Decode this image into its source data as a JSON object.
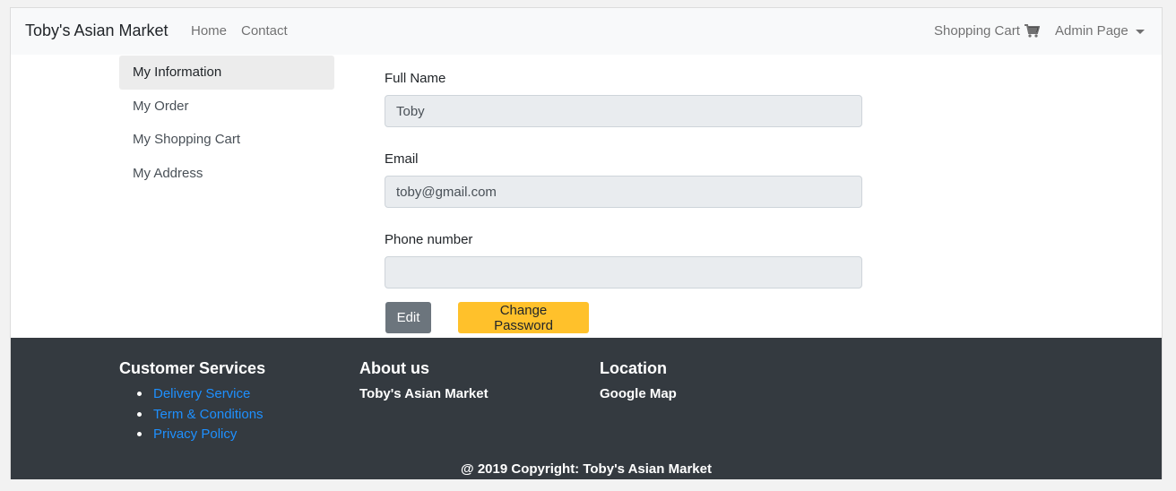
{
  "navbar": {
    "brand": "Toby's Asian Market",
    "links": [
      "Home",
      "Contact"
    ],
    "cart_label": "Shopping Cart",
    "admin_label": "Admin Page"
  },
  "sidebar": {
    "items": [
      {
        "label": "My Information"
      },
      {
        "label": "My Order"
      },
      {
        "label": "My Shopping Cart"
      },
      {
        "label": "My Address"
      }
    ]
  },
  "form": {
    "full_name_label": "Full Name",
    "full_name_value": "Toby",
    "email_label": "Email",
    "email_value": "toby@gmail.com",
    "phone_label": "Phone number",
    "phone_value": "",
    "edit_label": "Edit",
    "change_password_label": "Change Password"
  },
  "footer": {
    "services_title": "Customer Services",
    "services_links": [
      "Delivery Service",
      "Term & Conditions",
      "Privacy Policy"
    ],
    "about_title": "About us",
    "about_text": "Toby's Asian Market",
    "location_title": "Location",
    "location_text": "Google Map",
    "copyright": "@ 2019 Copyright: Toby's Asian Market"
  },
  "colors": {
    "navbar_bg": "#f8f9fa",
    "footer_bg": "#343a40",
    "edit_button": "#6c757d",
    "password_button": "#ffc12b",
    "link": "#1e90ff"
  },
  "icons": {
    "cart": "shopping-cart-icon",
    "dropdown": "caret-down-icon"
  }
}
